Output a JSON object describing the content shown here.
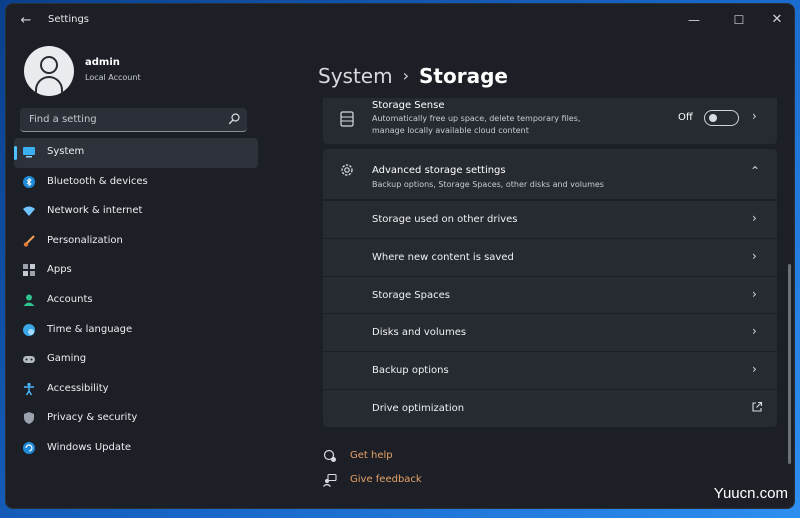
{
  "window": {
    "title": "Settings"
  },
  "profile": {
    "name": "admin",
    "account_type": "Local Account"
  },
  "search": {
    "placeholder": "Find a setting"
  },
  "sidebar": {
    "items": [
      {
        "label": "System",
        "icon": "monitor-icon",
        "active": true
      },
      {
        "label": "Bluetooth & devices",
        "icon": "bluetooth-icon"
      },
      {
        "label": "Network & internet",
        "icon": "wifi-icon"
      },
      {
        "label": "Personalization",
        "icon": "brush-icon"
      },
      {
        "label": "Apps",
        "icon": "apps-icon"
      },
      {
        "label": "Accounts",
        "icon": "person-icon"
      },
      {
        "label": "Time & language",
        "icon": "globe-icon"
      },
      {
        "label": "Gaming",
        "icon": "gamepad-icon"
      },
      {
        "label": "Accessibility",
        "icon": "accessibility-icon"
      },
      {
        "label": "Privacy & security",
        "icon": "shield-icon"
      },
      {
        "label": "Windows Update",
        "icon": "update-icon"
      }
    ]
  },
  "breadcrumb": {
    "parent": "System",
    "separator": "›",
    "current": "Storage"
  },
  "storage_sense": {
    "title": "Storage Sense",
    "description": "Automatically free up space, delete temporary files, manage locally available cloud content",
    "toggle_state": "Off"
  },
  "advanced": {
    "title": "Advanced storage settings",
    "description": "Backup options, Storage Spaces, other disks and volumes",
    "rows": [
      {
        "label": "Storage used on other drives"
      },
      {
        "label": "Where new content is saved"
      },
      {
        "label": "Storage Spaces"
      },
      {
        "label": "Disks and volumes"
      },
      {
        "label": "Backup options"
      },
      {
        "label": "Drive optimization"
      }
    ]
  },
  "help_links": {
    "get_help": "Get help",
    "give_feedback": "Give feedback"
  },
  "controls": {
    "back_glyph": "←",
    "minimize_glyph": "—",
    "maximize_glyph": "☐",
    "close_glyph": "✕",
    "chevron_right": "›",
    "chevron_up": "⌃"
  },
  "watermark": {
    "text": "Yuucn.com"
  },
  "colors": {
    "accent": "#4cc2ff",
    "link": "#e7a06a",
    "window_bg": "#1c2026",
    "card_bg": "#262a31"
  }
}
